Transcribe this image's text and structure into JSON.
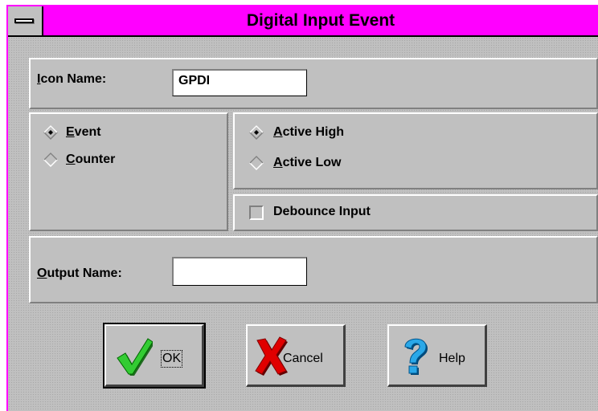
{
  "window": {
    "title": "Digital Input Event"
  },
  "icon_name": {
    "label_first": "I",
    "label_rest": "con Name:",
    "value": "GPDI"
  },
  "mode": {
    "options": [
      {
        "hotkey": "E",
        "rest": "vent",
        "selected": true
      },
      {
        "hotkey": "C",
        "rest": "ounter",
        "selected": false
      }
    ]
  },
  "polarity": {
    "options": [
      {
        "hotkey": "A",
        "rest": "ctive High",
        "selected": true
      },
      {
        "hotkey": "A",
        "rest": "ctive Low",
        "selected": false
      }
    ]
  },
  "debounce": {
    "label": "Debounce Input",
    "checked": false
  },
  "output_name": {
    "label_first": "O",
    "label_rest": "utput Name:",
    "value": ""
  },
  "buttons": {
    "ok": {
      "label": "OK",
      "icon": "checkmark-icon"
    },
    "cancel": {
      "label": "Cancel",
      "icon": "x-icon"
    },
    "help": {
      "label": "Help",
      "icon": "question-icon"
    }
  },
  "colors": {
    "titlebar": "#ff00ff",
    "face": "#c0c0c0"
  }
}
